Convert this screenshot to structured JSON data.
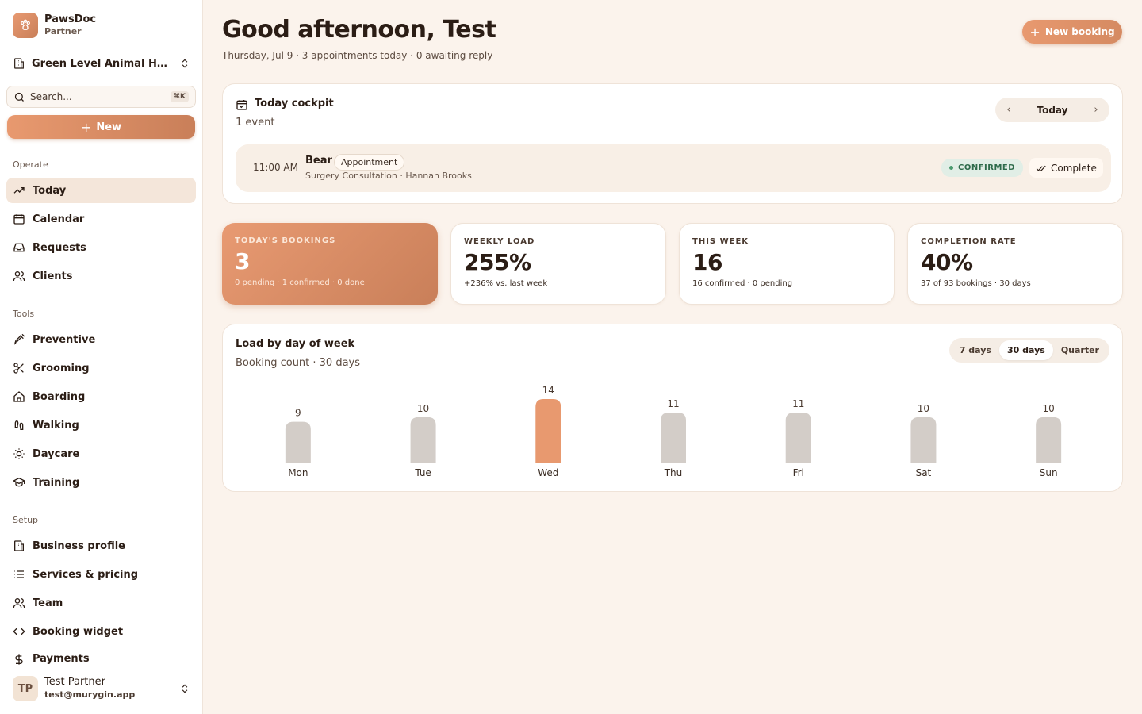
{
  "app": {
    "name": "PawsDoc",
    "role": "Partner"
  },
  "org": {
    "name": "Green Level Animal Hos..."
  },
  "search": {
    "placeholder": "Search...",
    "shortcut": "⌘K"
  },
  "sidebar": {
    "new_label": "New",
    "sections": [
      {
        "title": "Operate",
        "items": [
          {
            "label": "Today",
            "icon": "trending-icon",
            "active": true
          },
          {
            "label": "Calendar",
            "icon": "calendar-icon"
          },
          {
            "label": "Requests",
            "icon": "inbox-icon"
          },
          {
            "label": "Clients",
            "icon": "users-icon"
          }
        ]
      },
      {
        "title": "Tools",
        "items": [
          {
            "label": "Preventive",
            "icon": "syringe-icon"
          },
          {
            "label": "Grooming",
            "icon": "scissors-icon"
          },
          {
            "label": "Boarding",
            "icon": "home-icon"
          },
          {
            "label": "Walking",
            "icon": "footprints-icon"
          },
          {
            "label": "Daycare",
            "icon": "sun-icon"
          },
          {
            "label": "Training",
            "icon": "graduation-cap-icon"
          }
        ]
      },
      {
        "title": "Setup",
        "items": [
          {
            "label": "Business profile",
            "icon": "building-icon"
          },
          {
            "label": "Services & pricing",
            "icon": "list-icon"
          },
          {
            "label": "Team",
            "icon": "users-icon"
          },
          {
            "label": "Booking widget",
            "icon": "code-icon"
          },
          {
            "label": "Payments",
            "icon": "dollar-icon"
          }
        ]
      }
    ]
  },
  "user": {
    "initials": "TP",
    "name": "Test Partner",
    "email": "test@murygin.app"
  },
  "header": {
    "greeting": "Good afternoon, Test",
    "subline": "Thursday, Jul 9 · 3 appointments today · 0 awaiting reply",
    "new_booking_label": "New booking"
  },
  "cockpit": {
    "title": "Today cockpit",
    "count": "1 event",
    "date_label": "Today",
    "event": {
      "time": "11:00 AM",
      "pet": "Bear",
      "type": "Appointment",
      "detail": "Surgery Consultation · Hannah Brooks",
      "status": "CONFIRMED",
      "action": "Complete"
    }
  },
  "stats": [
    {
      "label": "TODAY'S BOOKINGS",
      "value": "3",
      "note": "0 pending · 1 confirmed · 0 done",
      "highlight": true
    },
    {
      "label": "WEEKLY LOAD",
      "value": "255%",
      "note": "+236% vs. last week"
    },
    {
      "label": "THIS WEEK",
      "value": "16",
      "note": "16 confirmed · 0 pending"
    },
    {
      "label": "COMPLETION RATE",
      "value": "40%",
      "note": "37 of 93 bookings · 30 days"
    }
  ],
  "load": {
    "title": "Load by day of week",
    "subtitle": "Booking count · 30 days",
    "ranges": [
      {
        "label": "7 days"
      },
      {
        "label": "30 days",
        "active": true
      },
      {
        "label": "Quarter"
      }
    ]
  },
  "colors": {
    "accent": "#e8996f",
    "bar": "#d3cdc8",
    "bar_highlight": "#e8996f"
  },
  "chart_data": {
    "type": "bar",
    "categories": [
      "Mon",
      "Tue",
      "Wed",
      "Thu",
      "Fri",
      "Sat",
      "Sun"
    ],
    "values": [
      9,
      10,
      14,
      11,
      11,
      10,
      10
    ],
    "highlight_index": 2,
    "title": "Load by day of week",
    "subtitle": "Booking count · 30 days",
    "ylim": [
      0,
      14
    ],
    "grid": false
  }
}
